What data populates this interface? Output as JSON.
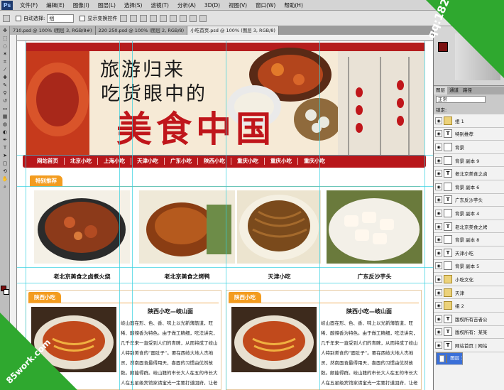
{
  "menubar": {
    "logo": "Ps",
    "items": [
      "文件(F)",
      "编辑(E)",
      "图像(I)",
      "图层(L)",
      "选择(S)",
      "滤镜(T)",
      "分析(A)",
      "3D(D)",
      "视图(V)",
      "窗口(W)",
      "帮助(H)"
    ],
    "zoom": "100%",
    "workspace": "基本功能"
  },
  "options": {
    "auto_select_label": "自动选择:",
    "auto_select_value": "组",
    "show_transform_label": "显示变换控件"
  },
  "doc_tabs": [
    "710.psd @ 100% (图层 3, RGB/8#)",
    "220 250.psd @ 100% (图层 2, RGB/8)",
    "小吃首页.psd @ 100% (图层 3, RGB/8)"
  ],
  "banner": {
    "line1": "旅游归来",
    "line2": "吃货眼中的",
    "line3": "美食中国"
  },
  "nav": [
    "网站首页",
    "北京小吃",
    "上海小吃",
    "天津小吃",
    "广东小吃",
    "陕西小吃",
    "重庆小吃",
    "重庆小吃",
    "重庆小吃"
  ],
  "featured": {
    "tab": "特别推荐",
    "items": [
      {
        "caption": "老北京美食之卤煮火烧"
      },
      {
        "caption": "老北京美食之烤鸭"
      },
      {
        "caption": "天津小吃"
      },
      {
        "caption": "广东反沙芋头"
      }
    ]
  },
  "articles": [
    {
      "tab": "陕西小吃",
      "title": "陕西小吃—岐山面",
      "body": "岐山面在形、色、香、味上以光新薄筋道，旺稀、酸辣香为特色。由于做工精细，吃法讲究，几千年来一直受到人们的青睐，从而将成了岐山人特别美食的“面肚子”。要在西岐大地人杰地灵，然南面食最得用天，喜面的习惯由优然故数。颇能得群。岐山籍的市长大人在五的市长大人在五星级宾馆家请宝光一定要打道回府，让老婆再擀上绝岐山面，这位老人是宝光是“三从四德”的“岐山哨子”，她的秘密……"
    },
    {
      "tab": "陕西小吃",
      "title": "陕西小吃—岐山面",
      "body": "岐山面在形、色、香、味上以光新薄筋道，旺稀、酸辣香为特色。由于做工精细，吃法讲究，几千年来一直受到人们的青睐，从而将成了岐山人特别美食的“面肚子”。要在西岐大地人杰地灵，然南面食最得用天，喜面的习惯由优然故数。颇能得群。岐山籍的市长大人在五的市长大人在五星级宾馆家请宝光一定要打道回府，让老婆再擀上绝岐山面，这位老人是宝光是“三从四德”的“岐山哨子”，她的秘密……"
    }
  ],
  "panel": {
    "tabs": [
      "图层",
      "通道",
      "路径"
    ],
    "blend": "正常",
    "lock": "锁定:",
    "layers": [
      {
        "name": "组 1",
        "type": "folder"
      },
      {
        "name": "特别推荐",
        "type": "text"
      },
      {
        "name": "背景",
        "type": "image"
      },
      {
        "name": "背景 副本 9",
        "type": "image"
      },
      {
        "name": "老北京美食之卤",
        "type": "text"
      },
      {
        "name": "背景 副本 6",
        "type": "image"
      },
      {
        "name": "广东反沙芋头",
        "type": "text"
      },
      {
        "name": "背景 副本 4",
        "type": "image"
      },
      {
        "name": "老北京美食之烤",
        "type": "text"
      },
      {
        "name": "背景 副本 8",
        "type": "image"
      },
      {
        "name": "天津小吃",
        "type": "text"
      },
      {
        "name": "背景 副本 5",
        "type": "image"
      },
      {
        "name": "小吃文化",
        "type": "folder"
      },
      {
        "name": "天津",
        "type": "folder"
      },
      {
        "name": "组 2",
        "type": "folder"
      },
      {
        "name": "版权所有吉者公",
        "type": "text"
      },
      {
        "name": "版权所有：某某",
        "type": "text"
      },
      {
        "name": "网站首页 | 网站",
        "type": "text"
      },
      {
        "name": "图层 3",
        "type": "image",
        "selected": true
      }
    ]
  },
  "watermarks": {
    "qq": "qq:1826816020",
    "site": "85work.com"
  }
}
